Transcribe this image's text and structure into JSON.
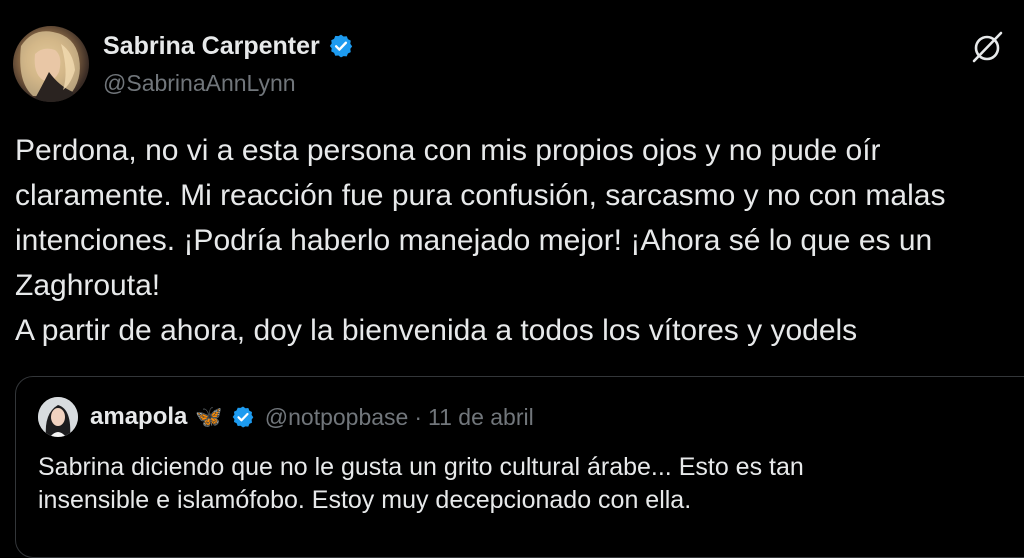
{
  "tweet": {
    "author": {
      "display_name": "Sabrina Carpenter",
      "handle": "@SabrinaAnnLynn",
      "verified": true
    },
    "grok_icon": "grok-icon",
    "body_lines": [
      "Perdona, no vi a esta persona con mis propios ojos y no pude oír",
      "claramente. Mi reacción fue pura confusión, sarcasmo y no con malas",
      "intenciones. ¡Podría haberlo manejado mejor! ¡Ahora sé lo que es un",
      "Zaghrouta!",
      "A partir de ahora, doy la bienvenida a todos los vítores y yodels"
    ]
  },
  "quoted_tweet": {
    "display_name": "amapola",
    "emoji": "🦋",
    "verified": true,
    "handle": "@notpopbase",
    "separator": "·",
    "date": "11 de abril",
    "text_lines": [
      "Sabrina diciendo que no le gusta un grito cultural árabe... Esto es tan",
      "insensible e islamófobo. Estoy muy decepcionado con ella."
    ]
  },
  "colors": {
    "background": "#000000",
    "text": "#e7e9ea",
    "secondary_text": "#71767b",
    "verified_badge": "#1d9bf0",
    "border": "#333639"
  }
}
